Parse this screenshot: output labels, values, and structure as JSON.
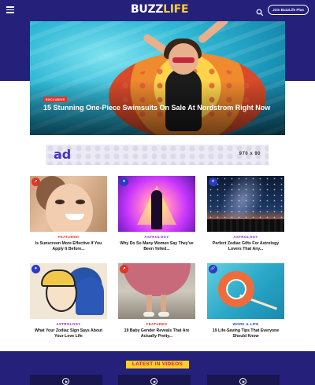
{
  "header": {
    "logo_part1": "BUZZ",
    "logo_part2": "LIFE",
    "join_label": "Join BuzzLife Plus",
    "accent": "#ffcf2d",
    "band_color": "#25207a"
  },
  "hero": {
    "tag": "EXCLUSIVE",
    "title": "15 Stunning One-Piece Swimsuits On Sale At Nordstrom Right Now"
  },
  "ad": {
    "logo": "ad",
    "size": "970 x 90"
  },
  "cards": [
    {
      "badge": "trending-icon",
      "category": "FEATURED",
      "title": "Is Sunscreen More Effective If You Apply It Before..."
    },
    {
      "badge": "new-icon",
      "category": "ASTROLOGY",
      "title": "Why Do So Many Women Say They've Been Yelled..."
    },
    {
      "badge": "new-icon",
      "category": "ASTROLOGY",
      "title": "Perfect Zodiac Gifts For Astrology Lovers That Any..."
    },
    {
      "badge": "new-icon",
      "category": "ASTROLOGY",
      "title": "What Your Zodiac Sign Says About Your Love Life"
    },
    {
      "badge": "trending-icon",
      "category": "FEATURED",
      "title": "19 Baby Gender Reveals That Are Actually Pretty..."
    },
    {
      "badge": "link-icon",
      "category": "WORK & LIFE",
      "title": "19 Life-Saving Tips That Everyone Should Know"
    }
  ],
  "videos": {
    "label": "LATEST IN VIDEOS"
  }
}
